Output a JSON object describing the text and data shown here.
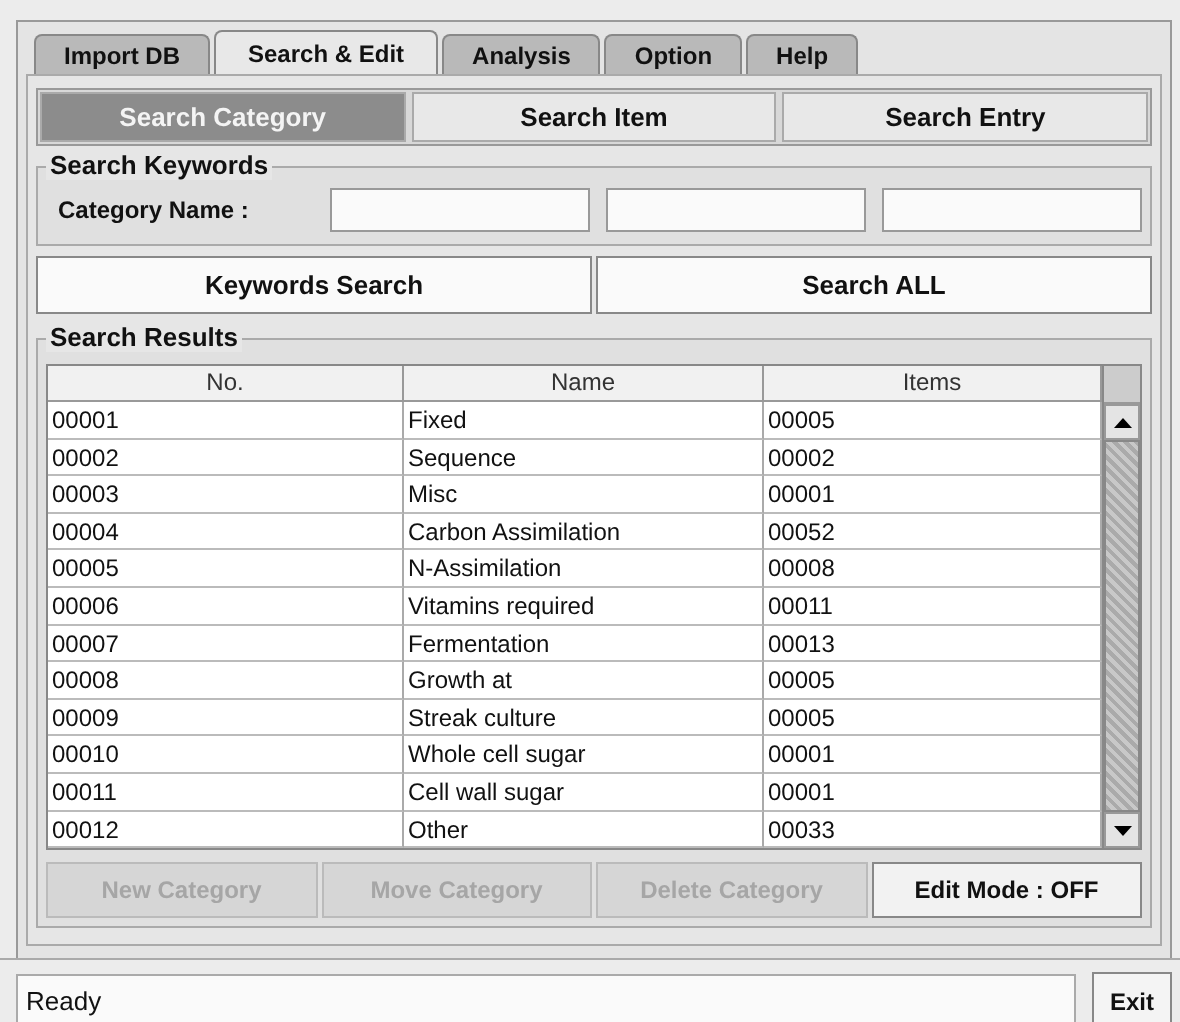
{
  "tabs": [
    {
      "label": "Import DB",
      "selected": false
    },
    {
      "label": "Search & Edit",
      "selected": true
    },
    {
      "label": "Analysis",
      "selected": false
    },
    {
      "label": "Option",
      "selected": false
    },
    {
      "label": "Help",
      "selected": false
    }
  ],
  "sub_tabs": [
    {
      "label": "Search Category",
      "selected": true
    },
    {
      "label": "Search Item",
      "selected": false
    },
    {
      "label": "Search Entry",
      "selected": false
    }
  ],
  "search_keywords": {
    "title": "Search Keywords",
    "label": "Category Name :"
  },
  "search_buttons": [
    "Keywords Search",
    "Search ALL"
  ],
  "search_results": {
    "title": "Search Results",
    "columns": [
      "No.",
      "Name",
      "Items"
    ],
    "rows": [
      [
        "00001",
        "Fixed",
        "00005"
      ],
      [
        "00002",
        "Sequence",
        "00002"
      ],
      [
        "00003",
        "Misc",
        "00001"
      ],
      [
        "00004",
        "Carbon Assimilation",
        "00052"
      ],
      [
        "00005",
        "N-Assimilation",
        "00008"
      ],
      [
        "00006",
        "Vitamins required",
        "00011"
      ],
      [
        "00007",
        "Fermentation",
        "00013"
      ],
      [
        "00008",
        "Growth at",
        "00005"
      ],
      [
        "00009",
        "Streak culture",
        "00005"
      ],
      [
        "00010",
        "Whole cell sugar",
        "00001"
      ],
      [
        "00011",
        "Cell wall sugar",
        "00001"
      ],
      [
        "00012",
        "Other",
        "00033"
      ]
    ]
  },
  "edit_buttons": [
    {
      "label": "New Category",
      "disabled": true
    },
    {
      "label": "Move Category",
      "disabled": true
    },
    {
      "label": "Delete Category",
      "disabled": true
    },
    {
      "label": "Edit Mode : OFF",
      "disabled": false
    }
  ],
  "status_bar": {
    "text": "Ready",
    "button": "Exit"
  }
}
